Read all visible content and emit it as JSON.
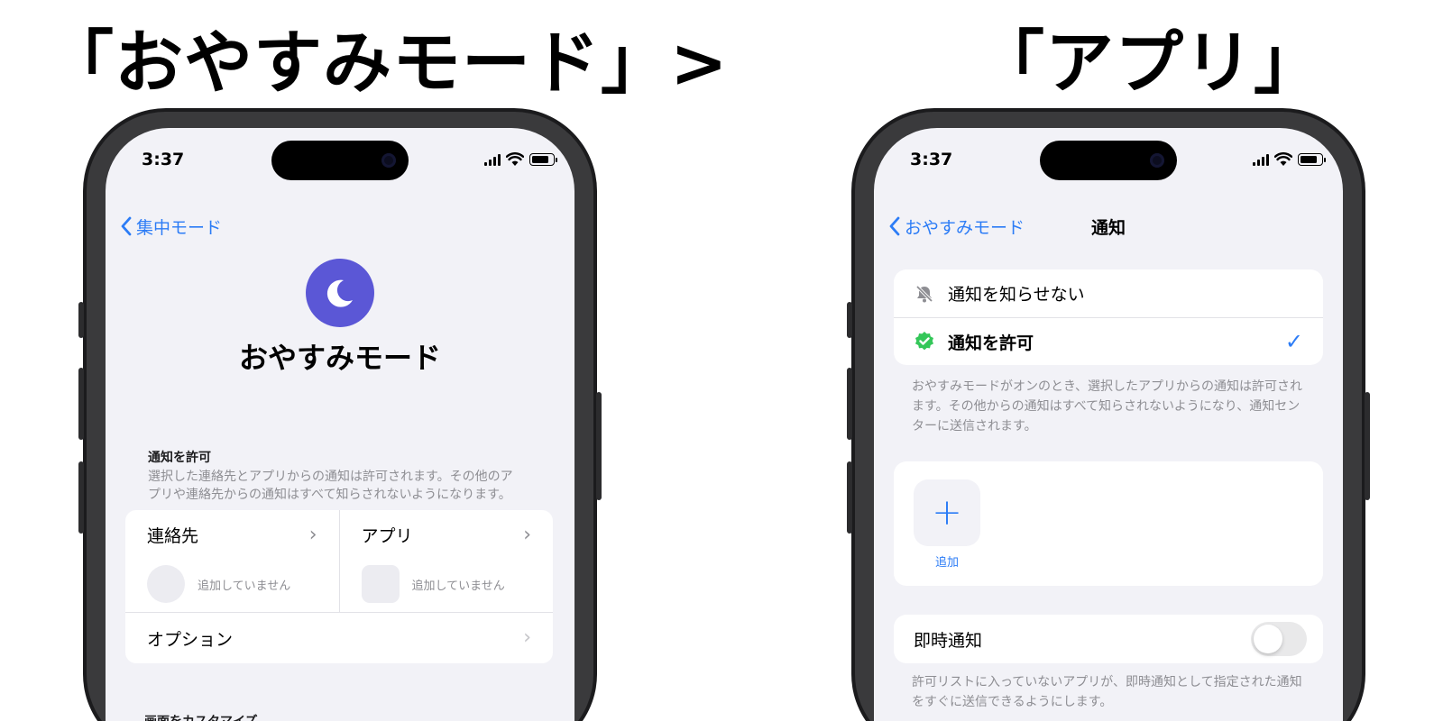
{
  "headlines": {
    "left": "「おやすみモード」>",
    "right": "「アプリ」"
  },
  "colors": {
    "accent": "#2c7cf6",
    "focus_icon": "#5b57d6",
    "allow_icon": "#34c759"
  },
  "left_phone": {
    "status": {
      "time": "3:37"
    },
    "nav": {
      "back_label": "集中モード"
    },
    "focus": {
      "icon": "moon-icon",
      "title": "おやすみモード"
    },
    "allow_section": {
      "header": "通知を許可",
      "description": "選択した連絡先とアプリからの通知は許可されます。その他のアプリや連絡先からの通知はすべて知らされないようになります。",
      "contacts": {
        "label": "連絡先",
        "sub": "追加していません"
      },
      "apps": {
        "label": "アプリ",
        "sub": "追加していません"
      },
      "options": {
        "label": "オプション"
      }
    },
    "customize_header": "画面をカスタマイズ"
  },
  "right_phone": {
    "status": {
      "time": "3:37"
    },
    "nav": {
      "back_label": "おやすみモード",
      "title": "通知"
    },
    "options": [
      {
        "label": "通知を知らせない",
        "icon": "bell-slash-icon",
        "selected": false
      },
      {
        "label": "通知を許可",
        "icon": "checkmark-seal-icon",
        "selected": true
      }
    ],
    "options_description": "おやすみモードがオンのとき、選択したアプリからの通知は許可されます。その他からの通知はすべて知らされないようになり、通知センターに送信されます。",
    "add": {
      "icon": "+",
      "label": "追加"
    },
    "time_sensitive": {
      "label": "即時通知",
      "on": false,
      "description": "許可リストに入っていないアプリが、即時通知として指定された通知をすぐに送信できるようにします。"
    }
  }
}
